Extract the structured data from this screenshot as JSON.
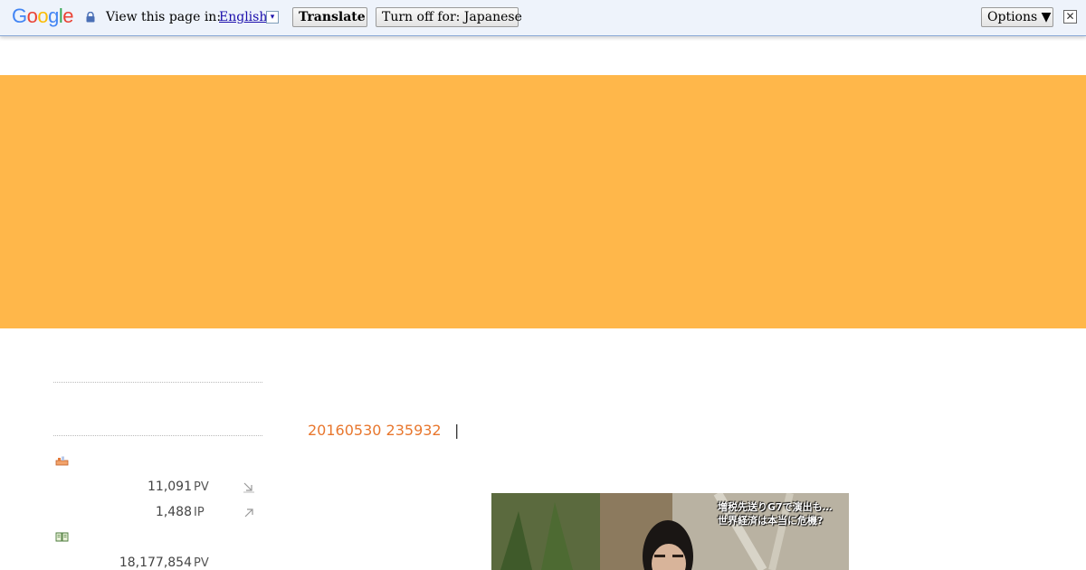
{
  "translate_bar": {
    "logo_text": "Google",
    "view_label": "View this page in:",
    "language": "English",
    "dropdown_glyph": "▾",
    "translate_label": "Translate",
    "turn_off_label": "Turn off for: Japanese",
    "options_label": "Options ▼",
    "close_glyph": "✕"
  },
  "banner": {
    "color": "#ffb74a"
  },
  "sidebar": {
    "stats_today": [
      {
        "value": "11,091",
        "unit": "PV"
      },
      {
        "value": "1,488",
        "unit": "IP"
      }
    ],
    "stats_total": [
      {
        "value": "18,177,854",
        "unit": "PV"
      }
    ]
  },
  "post": {
    "date": "20160530 235932",
    "separator": "|",
    "image_caption": "増税先送りG7で演出も…世界経済は本当に危機?"
  }
}
